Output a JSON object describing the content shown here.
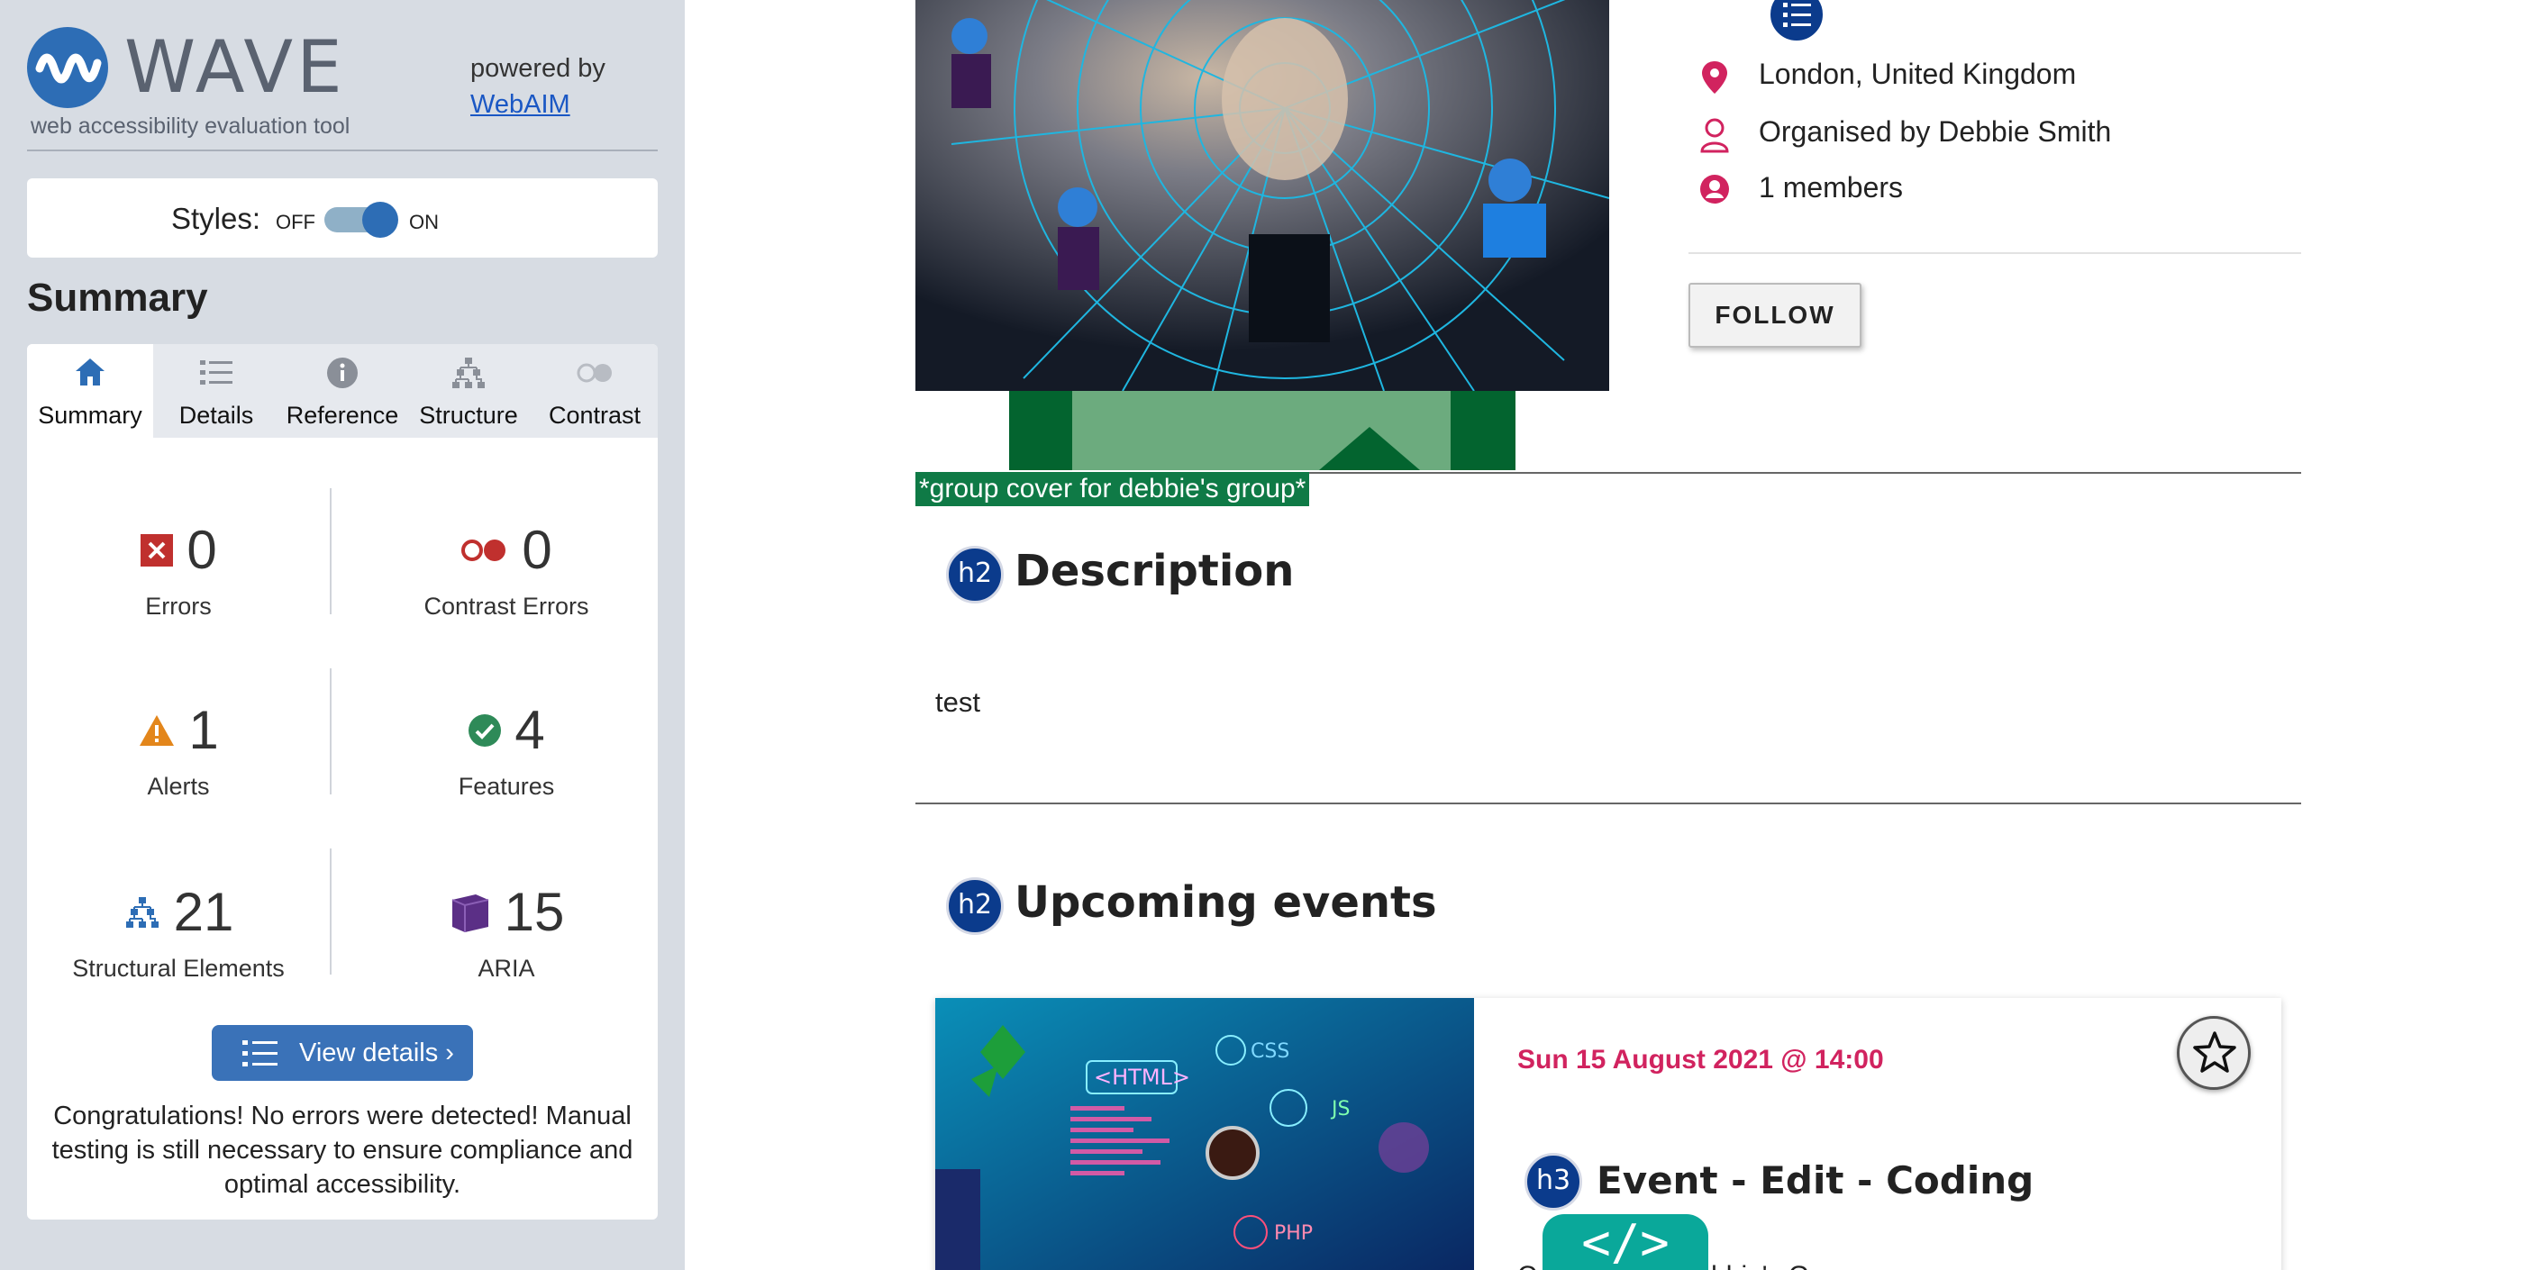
{
  "wave": {
    "name": "WAVE",
    "tagline": "web accessibility evaluation tool",
    "powered_by": "powered by",
    "powered_link": "WebAIM",
    "styles_label": "Styles:",
    "styles_off": "OFF",
    "styles_on": "ON",
    "summary_title": "Summary",
    "tabs": [
      {
        "label": "Summary",
        "icon": "home-icon",
        "active": true
      },
      {
        "label": "Details",
        "icon": "list-icon"
      },
      {
        "label": "Reference",
        "icon": "info-icon"
      },
      {
        "label": "Structure",
        "icon": "structure-icon"
      },
      {
        "label": "Contrast",
        "icon": "contrast-icon"
      }
    ],
    "stats": {
      "errors": {
        "value": "0",
        "label": "Errors"
      },
      "contrast_errors": {
        "value": "0",
        "label": "Contrast Errors"
      },
      "alerts": {
        "value": "1",
        "label": "Alerts"
      },
      "features": {
        "value": "4",
        "label": "Features"
      },
      "structural": {
        "value": "21",
        "label": "Structural Elements"
      },
      "aria": {
        "value": "15",
        "label": "ARIA"
      }
    },
    "view_details": "View details ›",
    "congrats": "Congratulations! No errors were detected! Manual testing is still necessary to ensure compliance and optimal accessibility."
  },
  "page": {
    "location": "London, United Kingdom",
    "organiser": "Organised by Debbie Smith",
    "members": "1 members",
    "follow": "FOLLOW",
    "cover_alt": "*group cover for debbie's group*",
    "h2_badge": "h2",
    "description_heading": "Description",
    "description_text": "test",
    "upcoming_heading": "Upcoming events",
    "event": {
      "date": "Sun 15 August 2021 @ 14:00",
      "h3_badge": "h3",
      "title": "Event - Edit - Coding",
      "subtitle": "C... Coding · Debbie's Group"
    },
    "code_badge": "</>"
  },
  "colors": {
    "wave_blue": "#2d6db5",
    "accent_pink": "#d1235f",
    "heading_badge": "#0b3b8c",
    "alt_green": "#0f7a46"
  }
}
